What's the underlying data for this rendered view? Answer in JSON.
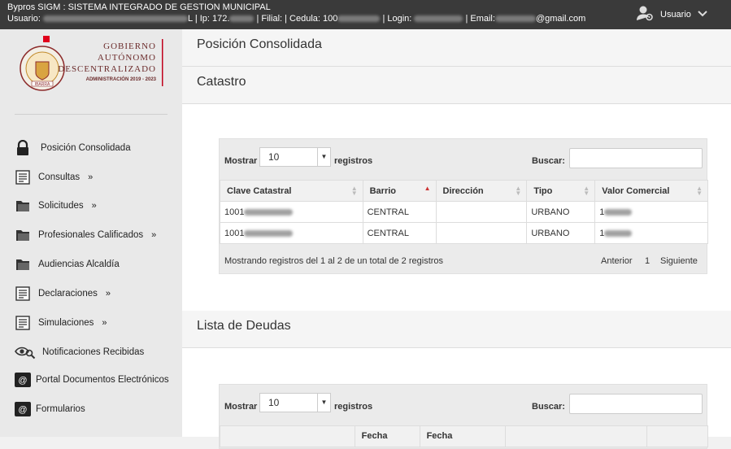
{
  "topbar": {
    "title": "Bypros SIGM : SISTEMA INTEGRADO DE GESTION MUNICIPAL",
    "usuario_label": "Usuario:",
    "usuario_suffix": "L",
    "ip_label": "| Ip: 172.",
    "filial_cedula": "| Filial: | Cedula: 100",
    "login_label": "| Login:",
    "email_label": "| Email:",
    "email_suffix": "@gmail.com",
    "user_menu_label": "Usuario"
  },
  "logo": {
    "line1": "GOBIERNO",
    "line2": "AUTÓNOMO",
    "line3": "DESCENTRALIZADO",
    "line4": "ADMINISTRACIÓN 2019 - 2023",
    "seal_text": "IBARRA"
  },
  "sidebar": {
    "items": [
      {
        "label": "Posición Consolidada",
        "icon": "lock-icon",
        "arrow": ""
      },
      {
        "label": "Consultas",
        "icon": "document-icon",
        "arrow": "»"
      },
      {
        "label": "Solicitudes",
        "icon": "folder-icon",
        "arrow": "»"
      },
      {
        "label": "Profesionales Calificados",
        "icon": "folder-icon",
        "arrow": "»"
      },
      {
        "label": "Audiencias Alcaldía",
        "icon": "folder-icon",
        "arrow": ""
      },
      {
        "label": "Declaraciones",
        "icon": "document-icon",
        "arrow": "»"
      },
      {
        "label": "Simulaciones",
        "icon": "document-icon",
        "arrow": "»"
      },
      {
        "label": "Notificaciones Recibidas",
        "icon": "eye-search-icon",
        "arrow": ""
      },
      {
        "label": "Portal Documentos Electrónicos",
        "icon": "at-sign-icon",
        "arrow": ""
      },
      {
        "label": "Formularios",
        "icon": "at-sign-icon",
        "arrow": ""
      }
    ]
  },
  "main": {
    "page_title": "Posición Consolidada",
    "catastro": {
      "title": "Catastro",
      "show_label": "Mostrar",
      "show_value": "10",
      "records_label": "registros",
      "search_label": "Buscar:",
      "columns": [
        "Clave Catastral",
        "Barrio",
        "Dirección",
        "Tipo",
        "Valor Comercial"
      ],
      "rows": [
        {
          "clave": "1001",
          "barrio": "CENTRAL",
          "direccion": "",
          "tipo": "URBANO",
          "valor": "1"
        },
        {
          "clave": "1001",
          "barrio": "CENTRAL",
          "direccion": "",
          "tipo": "URBANO",
          "valor": "1"
        }
      ],
      "info": "Mostrando registros del 1 al 2 de un total de 2 registros",
      "prev": "Anterior",
      "page": "1",
      "next": "Siguiente"
    },
    "deudas": {
      "title": "Lista de Deudas",
      "show_label": "Mostrar",
      "show_value": "10",
      "records_label": "registros",
      "search_label": "Buscar:",
      "columns": [
        "",
        "Fecha",
        "Fecha",
        "",
        ""
      ]
    }
  },
  "colors": {
    "topbar": "#3a3a3a",
    "sidebar": "#e9e9e9",
    "sort_active": "#cc3333"
  }
}
